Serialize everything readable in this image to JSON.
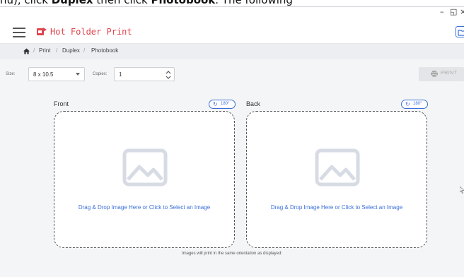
{
  "instruction": {
    "prefix": "nu), click ",
    "bold1": "Duplex",
    "middle": " then click ",
    "bold2": "Photobook",
    "suffix": ". The following"
  },
  "window": {
    "minimize": "–",
    "restore": "◱",
    "close": "×"
  },
  "app": {
    "title": "Hot Folder Print",
    "accent": "#e0444c",
    "link_color": "#3a6fd8"
  },
  "breadcrumb": {
    "items": [
      "Print",
      "Duplex",
      "Photobook"
    ],
    "separator": "/"
  },
  "toolbar": {
    "size_label": "Size:",
    "size_value": "8 x 10.5",
    "copies_label": "Copies:",
    "copies_value": "1",
    "print_label": "PRINT"
  },
  "panels": {
    "front": {
      "title": "Front",
      "rotate_label": "180°",
      "drop_text": "Drag & Drop Image Here or Click to Select an Image"
    },
    "back": {
      "title": "Back",
      "rotate_label": "180°",
      "drop_text": "Drag & Drop Image Here or Click to Select an Image"
    }
  },
  "note": "Images will print in the same orientation as displayed:",
  "icons": [
    "menu-icon",
    "app-logo-icon",
    "folder-icon",
    "home-icon",
    "dropdown-caret-icon",
    "stepper-icon",
    "printer-icon",
    "rotate-icon",
    "image-placeholder-icon",
    "cursor-icon"
  ]
}
